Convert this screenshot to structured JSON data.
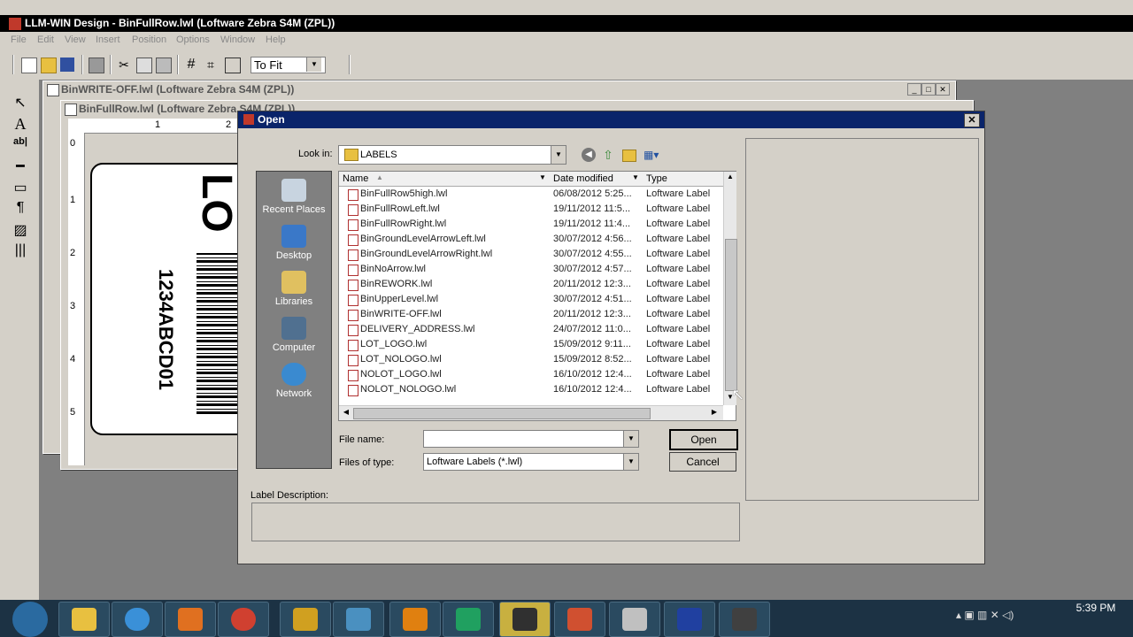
{
  "app": {
    "title": "LLM-WIN Design - BinFullRow.lwl (Loftware Zebra S4M (ZPL))",
    "menu": [
      "File",
      "Edit",
      "View",
      "Insert",
      "Position",
      "Options",
      "Window",
      "Help"
    ],
    "zoom": "To Fit"
  },
  "child_windows": [
    {
      "title": "BinWRITE-OFF.lwl (Loftware Zebra S4M (ZPL))"
    },
    {
      "title": "BinFullRow.lwl (Loftware Zebra S4M (ZPL))"
    }
  ],
  "ruler": {
    "top_marks": [
      "1",
      "2"
    ],
    "left_marks": [
      "0",
      "1",
      "2",
      "3",
      "4",
      "5"
    ]
  },
  "label_canvas": {
    "big_text": "LO",
    "vertical_text": "1234ABCD01"
  },
  "dialog": {
    "title": "Open",
    "look_in_label": "Look in:",
    "look_in_value": "LABELS",
    "places": [
      "Recent Places",
      "Desktop",
      "Libraries",
      "Computer",
      "Network"
    ],
    "columns": [
      "Name",
      "Date modified",
      "Type"
    ],
    "files": [
      {
        "name": "BinFullRow5high.lwl",
        "date": "06/08/2012 5:25...",
        "type": "Loftware Label"
      },
      {
        "name": "BinFullRowLeft.lwl",
        "date": "19/11/2012 11:5...",
        "type": "Loftware Label"
      },
      {
        "name": "BinFullRowRight.lwl",
        "date": "19/11/2012 11:4...",
        "type": "Loftware Label"
      },
      {
        "name": "BinGroundLevelArrowLeft.lwl",
        "date": "30/07/2012 4:56...",
        "type": "Loftware Label"
      },
      {
        "name": "BinGroundLevelArrowRight.lwl",
        "date": "30/07/2012 4:55...",
        "type": "Loftware Label"
      },
      {
        "name": "BinNoArrow.lwl",
        "date": "30/07/2012 4:57...",
        "type": "Loftware Label"
      },
      {
        "name": "BinREWORK.lwl",
        "date": "20/11/2012 12:3...",
        "type": "Loftware Label"
      },
      {
        "name": "BinUpperLevel.lwl",
        "date": "30/07/2012 4:51...",
        "type": "Loftware Label"
      },
      {
        "name": "BinWRITE-OFF.lwl",
        "date": "20/11/2012 12:3...",
        "type": "Loftware Label"
      },
      {
        "name": "DELIVERY_ADDRESS.lwl",
        "date": "24/07/2012 11:0...",
        "type": "Loftware Label"
      },
      {
        "name": "LOT_LOGO.lwl",
        "date": "15/09/2012 9:11...",
        "type": "Loftware Label"
      },
      {
        "name": "LOT_NOLOGO.lwl",
        "date": "15/09/2012 8:52...",
        "type": "Loftware Label"
      },
      {
        "name": "NOLOT_LOGO.lwl",
        "date": "16/10/2012 12:4...",
        "type": "Loftware Label"
      },
      {
        "name": "NOLOT_NOLOGO.lwl",
        "date": "16/10/2012 12:4...",
        "type": "Loftware Label"
      }
    ],
    "file_name_label": "File name:",
    "file_name_value": "",
    "files_of_type_label": "Files of type:",
    "files_of_type_value": "Loftware Labels (*.lwl)",
    "open_button": "Open",
    "cancel_button": "Cancel",
    "label_description_label": "Label Description:"
  },
  "taskbar": {
    "clock": "5:39 PM"
  }
}
